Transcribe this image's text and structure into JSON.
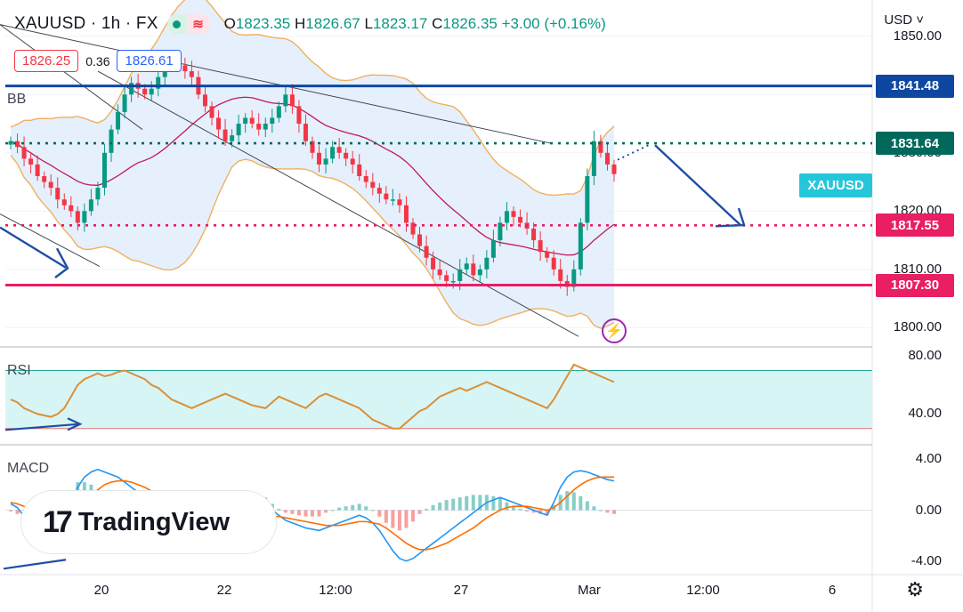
{
  "header": {
    "symbol": "XAUUSD · 1h · FX",
    "o_label": "O",
    "o": "1823.35",
    "h_label": "H",
    "h": "1826.67",
    "l_label": "L",
    "l": "1823.17",
    "c_label": "C",
    "c": "1826.35",
    "change": "+3.00 (+0.16%)",
    "market_status_icon": "market-open-dot-icon",
    "wave_icon": "wave-icon"
  },
  "quote": {
    "bid": "1826.25",
    "spread": "0.36",
    "ask": "1826.61"
  },
  "currency": "USD",
  "panes": {
    "main_indicator": "BB",
    "rsi": "RSI",
    "macd": "MACD"
  },
  "watermark": {
    "text": "TradingView"
  },
  "symbol_tag": "XAUUSD",
  "colors": {
    "up": "#089981",
    "down": "#f23645",
    "bb": "#f0b060",
    "bb_fill": "#dcebfb",
    "basis": "#c2185b",
    "blue_line": "#0d47a1",
    "green_dotted": "#00695c",
    "pink_dotted": "#e91e63",
    "pink_solid": "#e91e63",
    "rsi": "#d9903a",
    "rsi_band": "#d8f5f5",
    "macd": "#2196f3",
    "signal": "#ff6d00"
  },
  "chart_data": {
    "type": "candlestick",
    "price_axis": {
      "ticks": [
        "1850.00",
        "1840.00",
        "1830.00",
        "1820.00",
        "1810.00",
        "1800.00"
      ],
      "range": [
        1797,
        1855
      ]
    },
    "time_axis": {
      "labels": [
        "20",
        "22",
        "12:00",
        "27",
        "Mar",
        "12:00",
        "6"
      ]
    },
    "levels": [
      {
        "name": "blue-resistance",
        "price": 1841.48,
        "label": "1841.48",
        "style": "solid",
        "color": "#0d47a1"
      },
      {
        "name": "green-dotted",
        "price": 1831.64,
        "label": "1831.64",
        "style": "dotted",
        "color": "#00695c"
      },
      {
        "name": "pink-dotted",
        "price": 1817.55,
        "label": "1817.55",
        "style": "dotted",
        "color": "#e91e63"
      },
      {
        "name": "pink-support",
        "price": 1807.3,
        "label": "1807.30",
        "style": "solid",
        "color": "#e91e63"
      }
    ],
    "closes": [
      1832,
      1831,
      1829,
      1828,
      1826,
      1825,
      1824,
      1822,
      1821,
      1820,
      1818,
      1820,
      1822,
      1824,
      1830,
      1834,
      1837,
      1840,
      1842,
      1841,
      1840,
      1841,
      1843,
      1845,
      1846,
      1845,
      1844,
      1843,
      1840,
      1838,
      1836,
      1834,
      1832,
      1833,
      1835,
      1836,
      1835,
      1834,
      1835,
      1836,
      1838,
      1840,
      1838,
      1835,
      1832,
      1830,
      1828,
      1829,
      1831,
      1830,
      1829,
      1828,
      1826,
      1825,
      1824,
      1823,
      1822,
      1822,
      1821,
      1818,
      1816,
      1814,
      1812,
      1810,
      1809,
      1808,
      1808,
      1810,
      1811,
      1809,
      1810,
      1812,
      1815,
      1818,
      1820,
      1819,
      1818,
      1817,
      1815,
      1813,
      1812,
      1810,
      1808,
      1807,
      1810,
      1818,
      1826,
      1832,
      1830,
      1828,
      1826.35
    ],
    "rsi": {
      "ticks": [
        "80.00",
        "40.00"
      ],
      "range": [
        20,
        85
      ],
      "band": [
        30,
        70
      ],
      "values": [
        50,
        48,
        44,
        42,
        40,
        39,
        38,
        40,
        44,
        52,
        60,
        64,
        66,
        68,
        66,
        67,
        69,
        70,
        68,
        66,
        64,
        60,
        58,
        54,
        50,
        48,
        46,
        44,
        46,
        48,
        50,
        52,
        54,
        52,
        50,
        48,
        46,
        45,
        44,
        48,
        52,
        50,
        48,
        46,
        44,
        48,
        52,
        54,
        52,
        50,
        48,
        46,
        44,
        40,
        36,
        34,
        32,
        30,
        30,
        34,
        38,
        42,
        44,
        48,
        52,
        54,
        56,
        58,
        56,
        58,
        60,
        62,
        60,
        58,
        56,
        54,
        52,
        50,
        48,
        46,
        44,
        50,
        58,
        66,
        74,
        72,
        70,
        68,
        66,
        64,
        62
      ]
    },
    "macd": {
      "ticks": [
        "4.00",
        "0.00",
        "-4.00"
      ],
      "range": [
        -5,
        5
      ],
      "macd": [
        0.5,
        0.2,
        -0.5,
        -1.2,
        -1.8,
        -2.2,
        -2.5,
        -2.0,
        -1.0,
        0.5,
        1.8,
        2.6,
        3.0,
        3.2,
        3.0,
        2.8,
        2.6,
        2.2,
        1.8,
        1.4,
        1.0,
        0.6,
        0.2,
        -0.2,
        -0.6,
        -1.0,
        -1.4,
        -1.6,
        -1.8,
        -1.9,
        -1.8,
        -1.6,
        -1.4,
        -1.2,
        -1.0,
        -0.6,
        -0.2,
        0.2,
        0.4,
        0.0,
        -0.4,
        -0.8,
        -1.0,
        -1.2,
        -1.4,
        -1.5,
        -1.6,
        -1.4,
        -1.2,
        -1.0,
        -0.8,
        -0.6,
        -0.4,
        -0.6,
        -1.0,
        -1.6,
        -2.4,
        -3.2,
        -3.8,
        -4.0,
        -3.8,
        -3.4,
        -3.0,
        -2.6,
        -2.2,
        -1.8,
        -1.4,
        -1.0,
        -0.6,
        -0.2,
        0.2,
        0.6,
        0.8,
        1.0,
        0.8,
        0.6,
        0.4,
        0.2,
        0.0,
        -0.2,
        -0.4,
        0.6,
        1.8,
        2.6,
        3.0,
        3.1,
        3.0,
        2.8,
        2.6,
        2.4,
        2.3
      ],
      "signal": [
        0.6,
        0.5,
        0.3,
        0.0,
        -0.4,
        -0.8,
        -1.2,
        -1.4,
        -1.4,
        -1.0,
        -0.4,
        0.4,
        1.0,
        1.6,
        2.0,
        2.2,
        2.3,
        2.3,
        2.2,
        2.0,
        1.8,
        1.5,
        1.2,
        0.9,
        0.6,
        0.3,
        0.0,
        -0.3,
        -0.6,
        -0.8,
        -1.0,
        -1.1,
        -1.2,
        -1.2,
        -1.2,
        -1.1,
        -1.0,
        -0.8,
        -0.6,
        -0.5,
        -0.5,
        -0.6,
        -0.7,
        -0.8,
        -0.9,
        -1.0,
        -1.1,
        -1.2,
        -1.2,
        -1.2,
        -1.1,
        -1.0,
        -0.9,
        -0.9,
        -1.0,
        -1.1,
        -1.4,
        -1.8,
        -2.2,
        -2.6,
        -2.9,
        -3.1,
        -3.1,
        -3.0,
        -2.8,
        -2.6,
        -2.3,
        -2.0,
        -1.7,
        -1.4,
        -1.0,
        -0.6,
        -0.3,
        0.0,
        0.2,
        0.3,
        0.3,
        0.3,
        0.2,
        0.1,
        0.0,
        0.2,
        0.6,
        1.1,
        1.6,
        2.0,
        2.3,
        2.5,
        2.6,
        2.6,
        2.6
      ]
    }
  }
}
